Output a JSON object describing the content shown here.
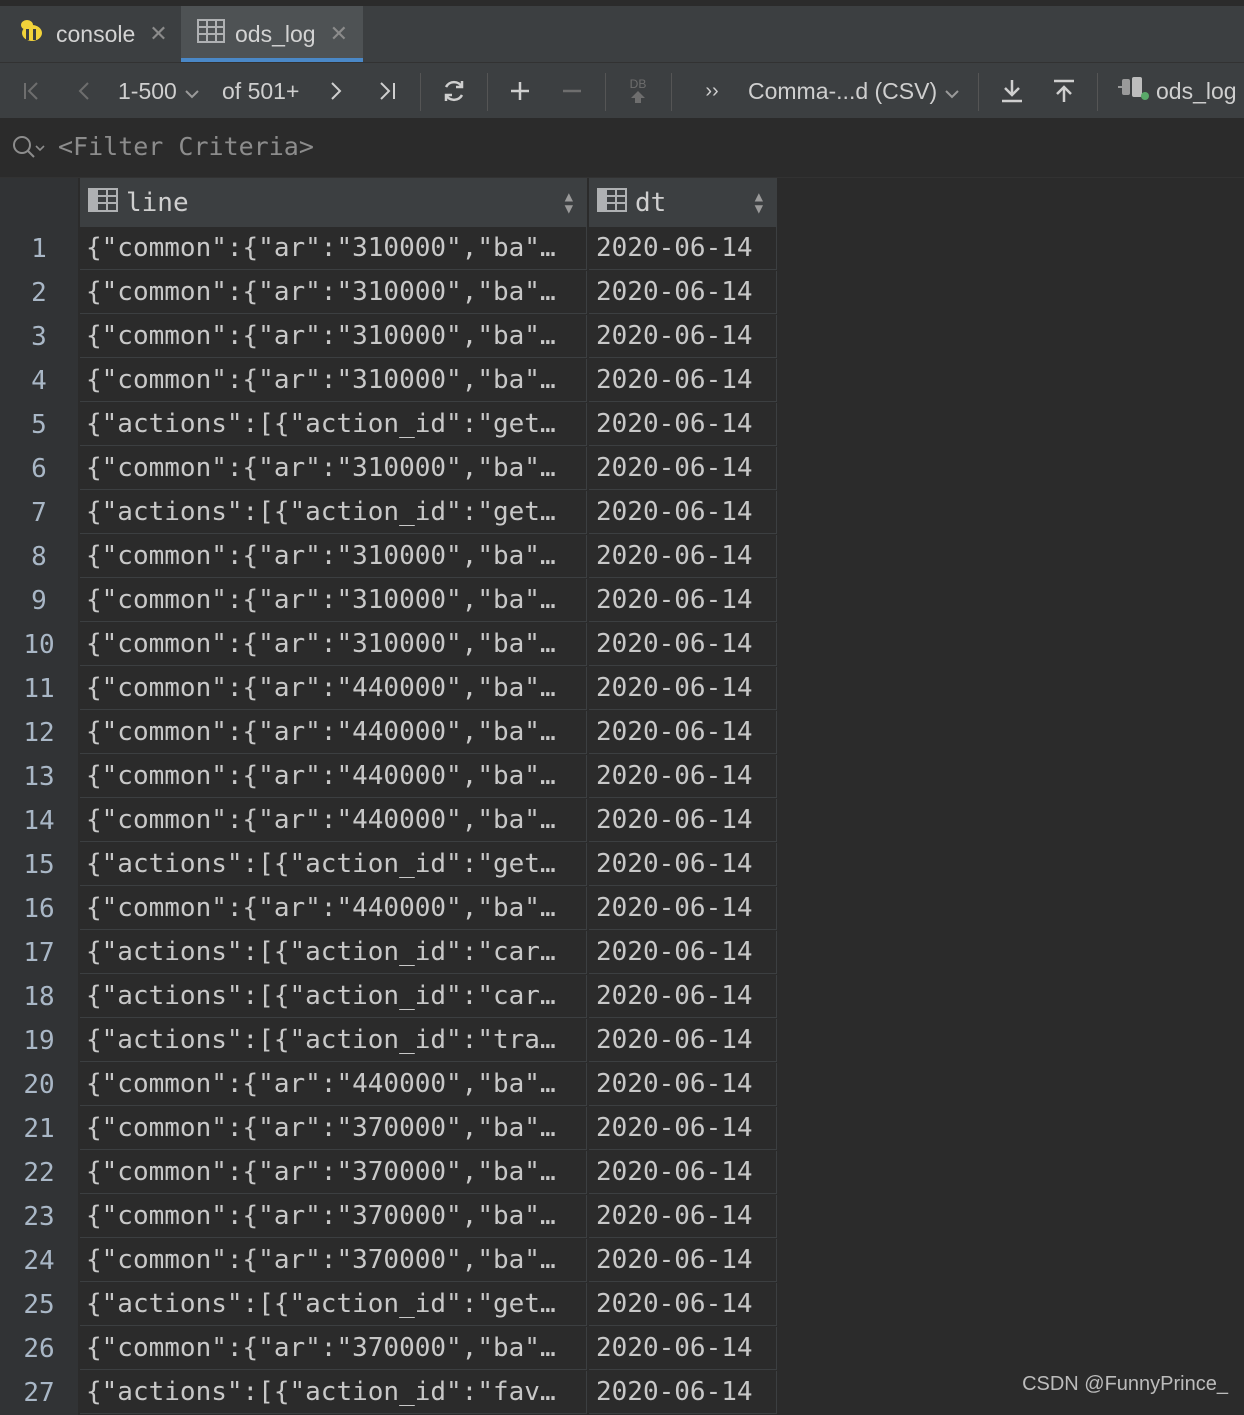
{
  "tabs": [
    {
      "label": "console",
      "icon": "hive-bee-icon",
      "active": false
    },
    {
      "label": "ods_log",
      "icon": "table-grid-icon",
      "active": true
    }
  ],
  "toolbar": {
    "range": "1-500",
    "of_total": "of 501+",
    "db_label": "DB",
    "format": "Comma-...d (CSV)",
    "target": "ods_log"
  },
  "filter": {
    "placeholder": "<Filter Criteria>"
  },
  "columns": [
    {
      "name": "line"
    },
    {
      "name": "dt"
    }
  ],
  "rows": [
    {
      "n": "1",
      "line": "{\"common\":{\"ar\":\"310000\",\"ba\"…",
      "dt": "2020-06-14"
    },
    {
      "n": "2",
      "line": "{\"common\":{\"ar\":\"310000\",\"ba\"…",
      "dt": "2020-06-14"
    },
    {
      "n": "3",
      "line": "{\"common\":{\"ar\":\"310000\",\"ba\"…",
      "dt": "2020-06-14"
    },
    {
      "n": "4",
      "line": "{\"common\":{\"ar\":\"310000\",\"ba\"…",
      "dt": "2020-06-14"
    },
    {
      "n": "5",
      "line": "{\"actions\":[{\"action_id\":\"get…",
      "dt": "2020-06-14"
    },
    {
      "n": "6",
      "line": "{\"common\":{\"ar\":\"310000\",\"ba\"…",
      "dt": "2020-06-14"
    },
    {
      "n": "7",
      "line": "{\"actions\":[{\"action_id\":\"get…",
      "dt": "2020-06-14"
    },
    {
      "n": "8",
      "line": "{\"common\":{\"ar\":\"310000\",\"ba\"…",
      "dt": "2020-06-14"
    },
    {
      "n": "9",
      "line": "{\"common\":{\"ar\":\"310000\",\"ba\"…",
      "dt": "2020-06-14"
    },
    {
      "n": "10",
      "line": "{\"common\":{\"ar\":\"310000\",\"ba\"…",
      "dt": "2020-06-14"
    },
    {
      "n": "11",
      "line": "{\"common\":{\"ar\":\"440000\",\"ba\"…",
      "dt": "2020-06-14"
    },
    {
      "n": "12",
      "line": "{\"common\":{\"ar\":\"440000\",\"ba\"…",
      "dt": "2020-06-14"
    },
    {
      "n": "13",
      "line": "{\"common\":{\"ar\":\"440000\",\"ba\"…",
      "dt": "2020-06-14"
    },
    {
      "n": "14",
      "line": "{\"common\":{\"ar\":\"440000\",\"ba\"…",
      "dt": "2020-06-14"
    },
    {
      "n": "15",
      "line": "{\"actions\":[{\"action_id\":\"get…",
      "dt": "2020-06-14"
    },
    {
      "n": "16",
      "line": "{\"common\":{\"ar\":\"440000\",\"ba\"…",
      "dt": "2020-06-14"
    },
    {
      "n": "17",
      "line": "{\"actions\":[{\"action_id\":\"car…",
      "dt": "2020-06-14"
    },
    {
      "n": "18",
      "line": "{\"actions\":[{\"action_id\":\"car…",
      "dt": "2020-06-14"
    },
    {
      "n": "19",
      "line": "{\"actions\":[{\"action_id\":\"tra…",
      "dt": "2020-06-14"
    },
    {
      "n": "20",
      "line": "{\"common\":{\"ar\":\"440000\",\"ba\"…",
      "dt": "2020-06-14"
    },
    {
      "n": "21",
      "line": "{\"common\":{\"ar\":\"370000\",\"ba\"…",
      "dt": "2020-06-14"
    },
    {
      "n": "22",
      "line": "{\"common\":{\"ar\":\"370000\",\"ba\"…",
      "dt": "2020-06-14"
    },
    {
      "n": "23",
      "line": "{\"common\":{\"ar\":\"370000\",\"ba\"…",
      "dt": "2020-06-14"
    },
    {
      "n": "24",
      "line": "{\"common\":{\"ar\":\"370000\",\"ba\"…",
      "dt": "2020-06-14"
    },
    {
      "n": "25",
      "line": "{\"actions\":[{\"action_id\":\"get…",
      "dt": "2020-06-14"
    },
    {
      "n": "26",
      "line": "{\"common\":{\"ar\":\"370000\",\"ba\"…",
      "dt": "2020-06-14"
    },
    {
      "n": "27",
      "line": "{\"actions\":[{\"action_id\":\"fav…",
      "dt": "2020-06-14"
    }
  ],
  "watermark": "CSDN @FunnyPrince_",
  "colors": {
    "accent": "#4a88c7",
    "background": "#2b2b2b",
    "toolbar": "#3c3f41"
  }
}
